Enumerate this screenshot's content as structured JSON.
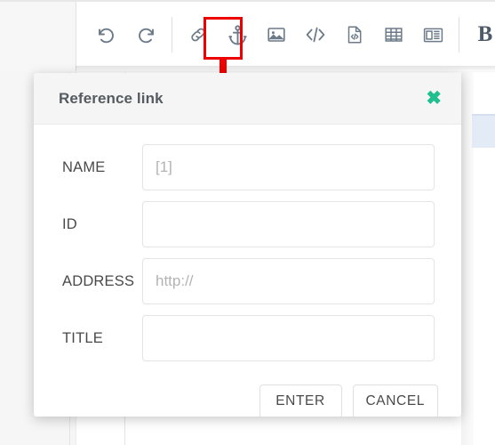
{
  "editor": {
    "toolbar": {
      "name": "editor-toolbar",
      "buttons": [
        {
          "icon": "undo-icon",
          "label": "Undo"
        },
        {
          "icon": "redo-icon",
          "label": "Redo"
        },
        {
          "icon": "separator",
          "label": ""
        },
        {
          "icon": "link-icon",
          "label": "Link"
        },
        {
          "icon": "anchor-icon",
          "label": "Reference link"
        },
        {
          "icon": "image-icon",
          "label": "Image"
        },
        {
          "icon": "code-icon",
          "label": "Inline code"
        },
        {
          "icon": "code-file-icon",
          "label": "Code block"
        },
        {
          "icon": "table-icon",
          "label": "Table"
        },
        {
          "icon": "newspaper-icon",
          "label": "Page break"
        },
        {
          "icon": "separator",
          "label": ""
        },
        {
          "icon": "bold-icon",
          "label": "B"
        }
      ]
    }
  },
  "annotation": {
    "highlight_color": "#ee0000",
    "arrow_color": "#ee0000",
    "target": "anchor-icon"
  },
  "dialog": {
    "title": "Reference link",
    "close_label": "✖",
    "close_color": "#21bf8f",
    "fields": [
      {
        "label": "NAME",
        "value": "",
        "placeholder": "[1]"
      },
      {
        "label": "ID",
        "value": "",
        "placeholder": ""
      },
      {
        "label": "ADDRESS",
        "value": "",
        "placeholder": "http://"
      },
      {
        "label": "TITLE",
        "value": "",
        "placeholder": ""
      }
    ],
    "buttons": [
      {
        "label": "ENTER"
      },
      {
        "label": "CANCEL"
      }
    ]
  }
}
